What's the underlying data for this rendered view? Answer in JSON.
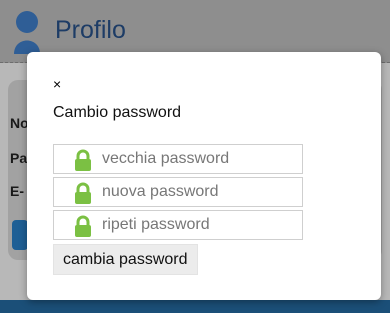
{
  "page": {
    "title": "Profilo",
    "labels": [
      "No",
      "Pa",
      "E-"
    ]
  },
  "modal": {
    "close_label": "×",
    "title": "Cambio password",
    "fields": [
      {
        "placeholder": "vecchia password"
      },
      {
        "placeholder": "nuova password"
      },
      {
        "placeholder": "ripeti password"
      }
    ],
    "submit_label": "cambia password"
  },
  "colors": {
    "lock_green": "#7bc043",
    "brand_blue": "#1d3c66"
  }
}
